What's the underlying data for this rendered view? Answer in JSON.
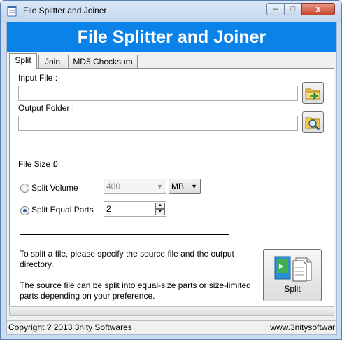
{
  "window": {
    "title": "File Splitter and Joiner",
    "minimize_glyph": "–",
    "maximize_glyph": "□",
    "close_glyph": "x"
  },
  "banner": {
    "text": "File Splitter and Joiner"
  },
  "tabs": [
    {
      "label": "Split",
      "active": true
    },
    {
      "label": "Join",
      "active": false
    },
    {
      "label": "MD5 Checksum",
      "active": false
    }
  ],
  "split": {
    "input_file_label": "Input File :",
    "input_file_value": "",
    "output_folder_label": "Output Folder :",
    "output_folder_value": "",
    "file_size_label": "File Size :",
    "file_size_value": "0",
    "split_volume_label": "Split Volume",
    "split_volume_checked": false,
    "volume_value": "400",
    "unit_value": "MB",
    "split_equal_label": "Split Equal Parts",
    "split_equal_checked": true,
    "parts_value": "2",
    "help_line1": "To split a file, please specify the source file and the output",
    "help_line2": "directory.",
    "help_line3": "The source file can be split into equal-size parts or size-limited",
    "help_line4": "parts depending on your preference.",
    "split_button_label": "Split",
    "status_text": "..."
  },
  "statusbar": {
    "copyright": "Copyright ? 2013 3nity Softwares",
    "website": "www.3nitysoftwar"
  },
  "icons": {
    "app": "app-icon",
    "browse_input": "folder-open-icon",
    "browse_output": "folder-search-icon",
    "split": "split-document-icon"
  }
}
